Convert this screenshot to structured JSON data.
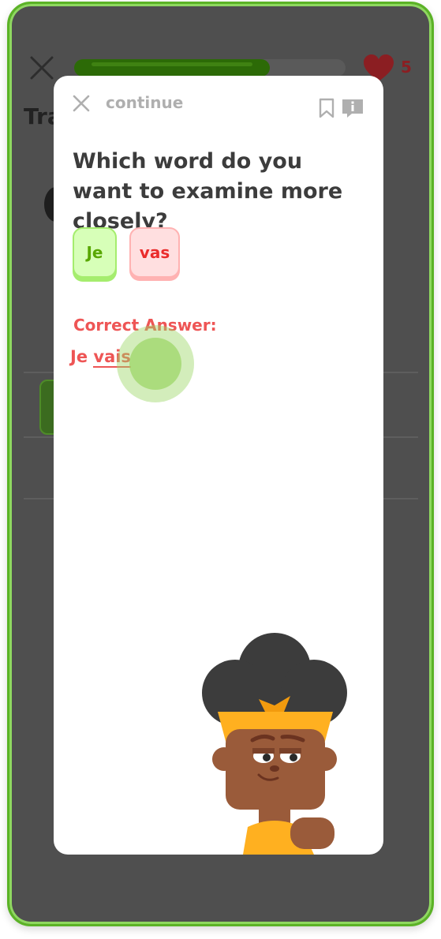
{
  "background": {
    "title_partial": "Tra",
    "hearts_count": "5",
    "progress": 0.72
  },
  "modal": {
    "continue_label": "continue",
    "question": "Which word do you want to examine more closely?",
    "choices": [
      {
        "label": "Je",
        "state": "correct"
      },
      {
        "label": "vas",
        "state": "incorrect"
      }
    ],
    "correct_answer_label": "Correct Answer:",
    "answer_word1": "Je",
    "answer_word2": "vais"
  },
  "icons": {
    "close": "close-icon",
    "heart": "heart-icon",
    "bookmark": "bookmark-icon",
    "info": "info-icon",
    "character": "character-illustration"
  },
  "colors": {
    "frame_border": "#5bb326",
    "overlay": "#4f4f4f",
    "correct_green": "#58a700",
    "incorrect_red": "#ea2b2b",
    "answer_red": "#ee5555"
  }
}
